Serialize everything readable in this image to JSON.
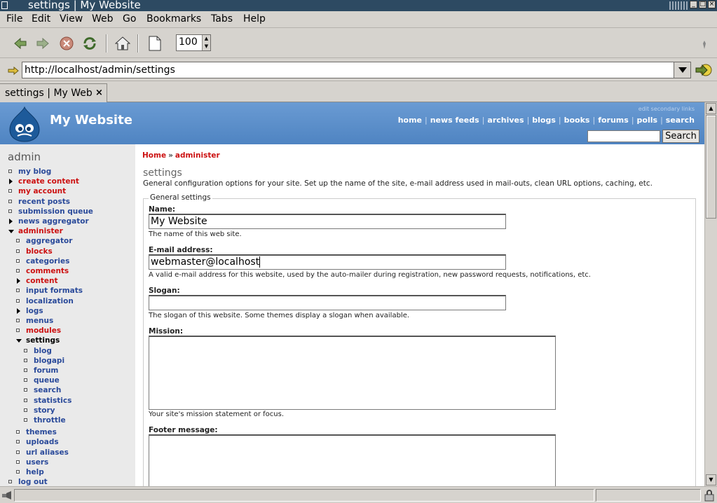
{
  "window": {
    "title": "settings | My Website"
  },
  "menu": [
    "File",
    "Edit",
    "View",
    "Web",
    "Go",
    "Bookmarks",
    "Tabs",
    "Help"
  ],
  "toolbar": {
    "zoom": "100"
  },
  "url": "http://localhost/admin/settings",
  "tab": {
    "label": "settings | My Web",
    "close": "×"
  },
  "site": {
    "name": "My Website",
    "secondary_links": "edit secondary links",
    "primary_links": [
      "home",
      "news feeds",
      "archives",
      "blogs",
      "books",
      "forums",
      "polls",
      "search"
    ],
    "search_button": "Search"
  },
  "sidebar": {
    "title": "admin",
    "items": [
      {
        "label": "my blog",
        "color": "blue",
        "marker": "bullet",
        "indent": 0
      },
      {
        "label": "create content",
        "color": "red",
        "marker": "collapsed",
        "indent": 0
      },
      {
        "label": "my account",
        "color": "red",
        "marker": "bullet",
        "indent": 0
      },
      {
        "label": "recent posts",
        "color": "blue",
        "marker": "bullet",
        "indent": 0
      },
      {
        "label": "submission queue",
        "color": "blue",
        "marker": "bullet",
        "indent": 0
      },
      {
        "label": "news aggregator",
        "color": "blue",
        "marker": "collapsed",
        "indent": 0
      },
      {
        "label": "administer",
        "color": "red",
        "marker": "expanded",
        "indent": 0
      },
      {
        "label": "aggregator",
        "color": "blue",
        "marker": "bullet",
        "indent": 1
      },
      {
        "label": "blocks",
        "color": "red",
        "marker": "bullet",
        "indent": 1
      },
      {
        "label": "categories",
        "color": "blue",
        "marker": "bullet",
        "indent": 1
      },
      {
        "label": "comments",
        "color": "red",
        "marker": "bullet",
        "indent": 1
      },
      {
        "label": "content",
        "color": "red",
        "marker": "collapsed",
        "indent": 1
      },
      {
        "label": "input formats",
        "color": "blue",
        "marker": "bullet",
        "indent": 1
      },
      {
        "label": "localization",
        "color": "blue",
        "marker": "bullet",
        "indent": 1
      },
      {
        "label": "logs",
        "color": "blue",
        "marker": "collapsed",
        "indent": 1
      },
      {
        "label": "menus",
        "color": "blue",
        "marker": "bullet",
        "indent": 1
      },
      {
        "label": "modules",
        "color": "red",
        "marker": "bullet",
        "indent": 1
      },
      {
        "label": "settings",
        "color": "black",
        "marker": "expanded",
        "indent": 1
      },
      {
        "label": "blog",
        "color": "blue",
        "marker": "bullet",
        "indent": 2
      },
      {
        "label": "blogapi",
        "color": "blue",
        "marker": "bullet",
        "indent": 2
      },
      {
        "label": "forum",
        "color": "blue",
        "marker": "bullet",
        "indent": 2
      },
      {
        "label": "queue",
        "color": "blue",
        "marker": "bullet",
        "indent": 2
      },
      {
        "label": "search",
        "color": "blue",
        "marker": "bullet",
        "indent": 2
      },
      {
        "label": "statistics",
        "color": "blue",
        "marker": "bullet",
        "indent": 2
      },
      {
        "label": "story",
        "color": "blue",
        "marker": "bullet",
        "indent": 2
      },
      {
        "label": "throttle",
        "color": "blue",
        "marker": "bullet",
        "indent": 2
      },
      {
        "label": "themes",
        "color": "blue",
        "marker": "bullet",
        "indent": 1
      },
      {
        "label": "uploads",
        "color": "blue",
        "marker": "bullet",
        "indent": 1
      },
      {
        "label": "url aliases",
        "color": "blue",
        "marker": "bullet",
        "indent": 1
      },
      {
        "label": "users",
        "color": "blue",
        "marker": "bullet",
        "indent": 1
      },
      {
        "label": "help",
        "color": "blue",
        "marker": "bullet",
        "indent": 1
      },
      {
        "label": "log out",
        "color": "blue",
        "marker": "bullet",
        "indent": 0
      }
    ]
  },
  "breadcrumb": {
    "home": "Home",
    "sep": "»",
    "administer": "administer"
  },
  "page": {
    "title": "settings",
    "description": "General configuration options for your site. Set up the name of the site, e-mail address used in mail-outs, clean URL options, caching, etc."
  },
  "form": {
    "legend": "General settings",
    "name": {
      "label": "Name:",
      "value": "My Website",
      "help": "The name of this web site."
    },
    "email": {
      "label": "E-mail address:",
      "value": "webmaster@localhost",
      "help": "A valid e-mail address for this website, used by the auto-mailer during registration, new password requests, notifications, etc."
    },
    "slogan": {
      "label": "Slogan:",
      "value": "",
      "help": "The slogan of this website. Some themes display a slogan when available."
    },
    "mission": {
      "label": "Mission:",
      "help": "Your site's mission statement or focus."
    },
    "footer": {
      "label": "Footer message:"
    }
  },
  "colors": {
    "header": "#5b8ec9",
    "link_blue": "#2a4a9a",
    "link_red": "#cc1111",
    "titlebar": "#2d4a62"
  }
}
